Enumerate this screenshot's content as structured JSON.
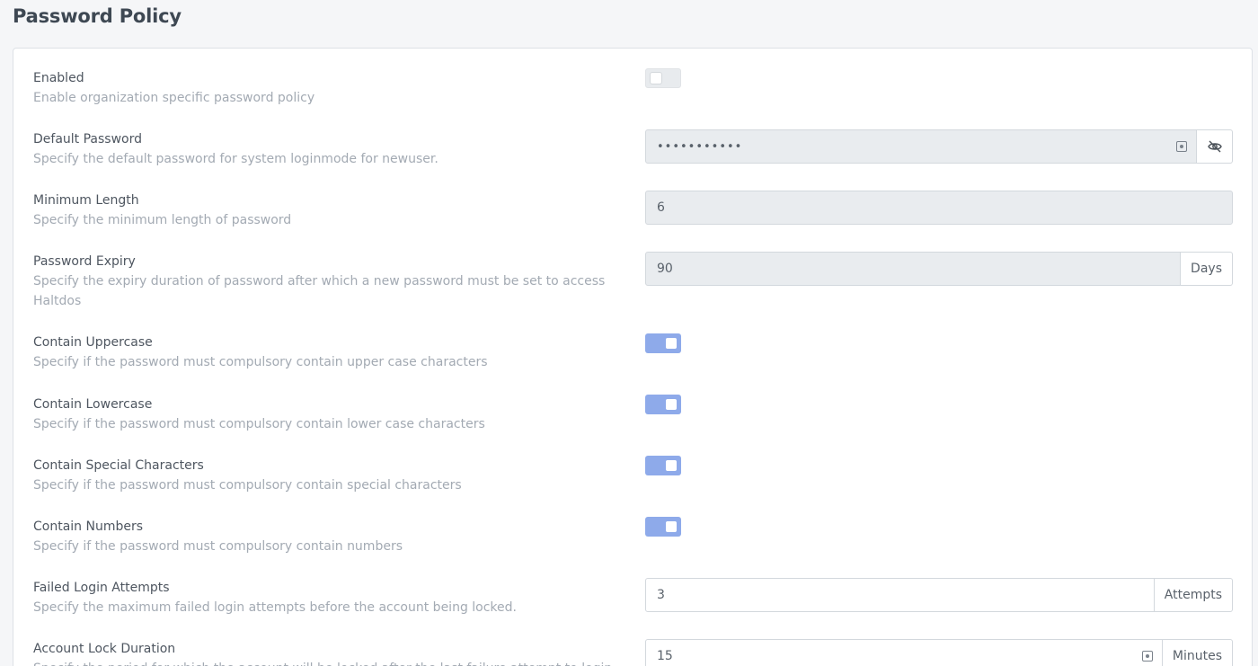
{
  "page": {
    "title": "Password Policy"
  },
  "settings": [
    {
      "key": "enabled",
      "label": "Enabled",
      "desc": "Enable organization specific password policy",
      "type": "toggle",
      "on": false
    },
    {
      "key": "default_password",
      "label": "Default Password",
      "desc": "Specify the default password for system loginmode for newuser.",
      "type": "password",
      "value": "•••••••••••",
      "icons": [
        "autofill-icon",
        "eye-slash-icon"
      ]
    },
    {
      "key": "minimum_length",
      "label": "Minimum Length",
      "desc": "Specify the minimum length of password",
      "type": "input",
      "value": "6"
    },
    {
      "key": "password_expiry",
      "label": "Password Expiry",
      "desc": "Specify the expiry duration of password after which a new password must be set to access Haltdos",
      "type": "input-addon",
      "value": "90",
      "unit": "Days"
    },
    {
      "key": "contain_uppercase",
      "label": "Contain Uppercase",
      "desc": "Specify if the password must compulsory contain upper case characters",
      "type": "toggle",
      "on": true
    },
    {
      "key": "contain_lowercase",
      "label": "Contain Lowercase",
      "desc": "Specify if the password must compulsory contain lower case characters",
      "type": "toggle",
      "on": true
    },
    {
      "key": "contain_special",
      "label": "Contain Special Characters",
      "desc": "Specify if the password must compulsory contain special characters",
      "type": "toggle",
      "on": true
    },
    {
      "key": "contain_numbers",
      "label": "Contain Numbers",
      "desc": "Specify if the password must compulsory contain numbers",
      "type": "toggle",
      "on": true
    },
    {
      "key": "failed_login_attempts",
      "label": "Failed Login Attempts",
      "desc": "Specify the maximum failed login attempts before the account being locked.",
      "type": "input-addon",
      "value": "3",
      "unit": "Attempts"
    },
    {
      "key": "account_lock_duration",
      "label": "Account Lock Duration",
      "desc": "Specify the period for which the account will be locked after the last failure attempt to login",
      "type": "input-addon",
      "value": "15",
      "unit": "Minutes"
    }
  ]
}
